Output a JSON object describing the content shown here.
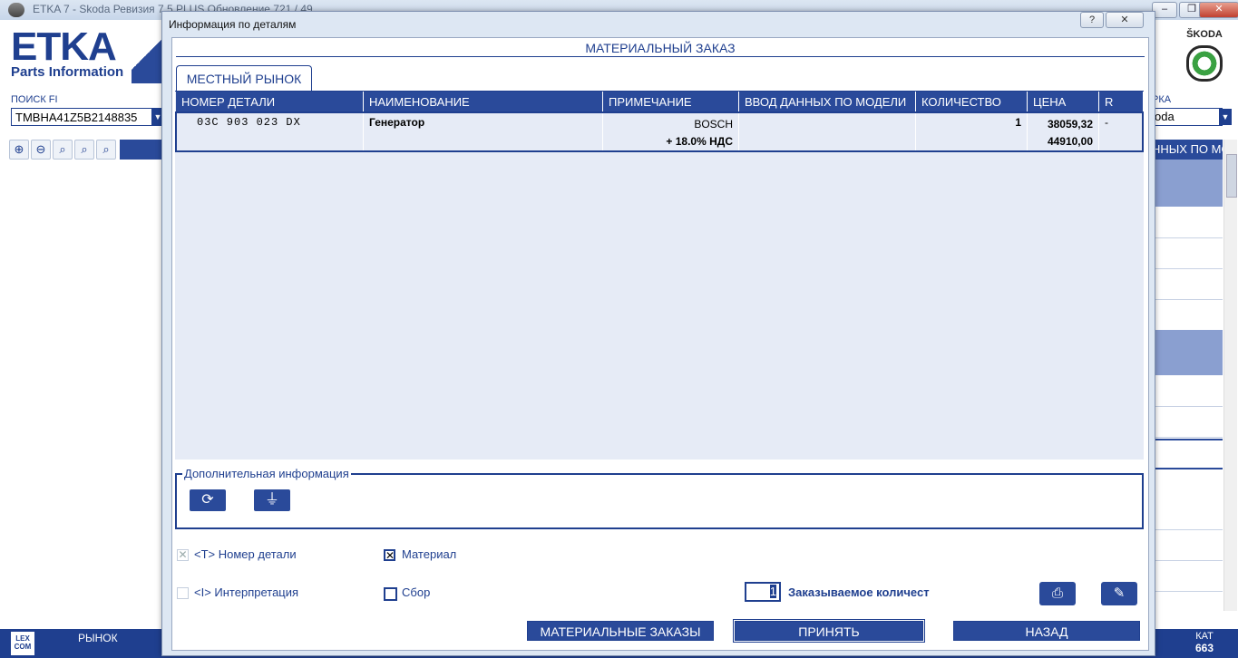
{
  "app": {
    "window_title": "ETKA 7 - Skoda Ревизия 7.5 PLUS Обновление 721 / 49",
    "window_buttons": {
      "minimize": "–",
      "restore": "❐",
      "close": "✕"
    },
    "logo_main": "ETKA",
    "logo_sub": "Parts Information",
    "brand": "ŠKODA",
    "search_label": "ПОИСК FI",
    "vin_value": "TMBHA41Z5B2148835",
    "brand_label": "РКА",
    "brand_value": "oda",
    "right_header": "ННЫХ ПО МО",
    "status_left": "РЫНОК",
    "lexcom": "LEX COM",
    "kat_label": "КАТ",
    "kat_value": "663",
    "zoom_icons": [
      "zoom-in-icon",
      "zoom-out-icon",
      "zoom-fit-icon",
      "zoom-width-icon",
      "zoom-icon"
    ]
  },
  "dialog": {
    "title": "Информация по деталям",
    "help_btn": "?",
    "close_btn": "✕",
    "header": "МАТЕРИАЛЬНЫЙ ЗАКАЗ",
    "tab": "МЕСТНЫЙ РЫНОК",
    "columns": [
      "НОМЕР ДЕТАЛИ",
      "НАИМЕНОВАНИЕ",
      "ПРИМЕЧАНИЕ",
      "ВВОД ДАННЫХ ПО МОДЕЛИ",
      "КОЛИЧЕСТВО",
      "ЦЕНА",
      "R"
    ],
    "rows": [
      {
        "part_no": "03C 903 023 DX",
        "name": "Генератор",
        "note1": "BOSCH",
        "note2": "+ 18.0% НДС",
        "model": "",
        "qty": "1",
        "price1": "38059,32",
        "price2": "44910,00",
        "r": "-"
      }
    ],
    "additional_info": "Дополнительная информация",
    "checkboxes": {
      "part_number": {
        "label": "<T> Номер детали",
        "checked": true
      },
      "material": {
        "label": "Материал",
        "checked": true
      },
      "interpretation": {
        "label": "<I> Интерпретация",
        "checked": false
      },
      "assembly": {
        "label": "Сбор",
        "checked": false
      }
    },
    "check_mark": "✕",
    "order_qty_value": "1",
    "order_qty_label": "Заказываемое количест",
    "buttons": {
      "material_orders": "МАТЕРИАЛЬНЫЕ ЗАКАЗЫ",
      "accept": "ПРИНЯТЬ",
      "back": "НАЗАД"
    },
    "icons": {
      "refresh": "⟳",
      "link": "⏚",
      "print": "⎙",
      "edit": "✎"
    }
  }
}
